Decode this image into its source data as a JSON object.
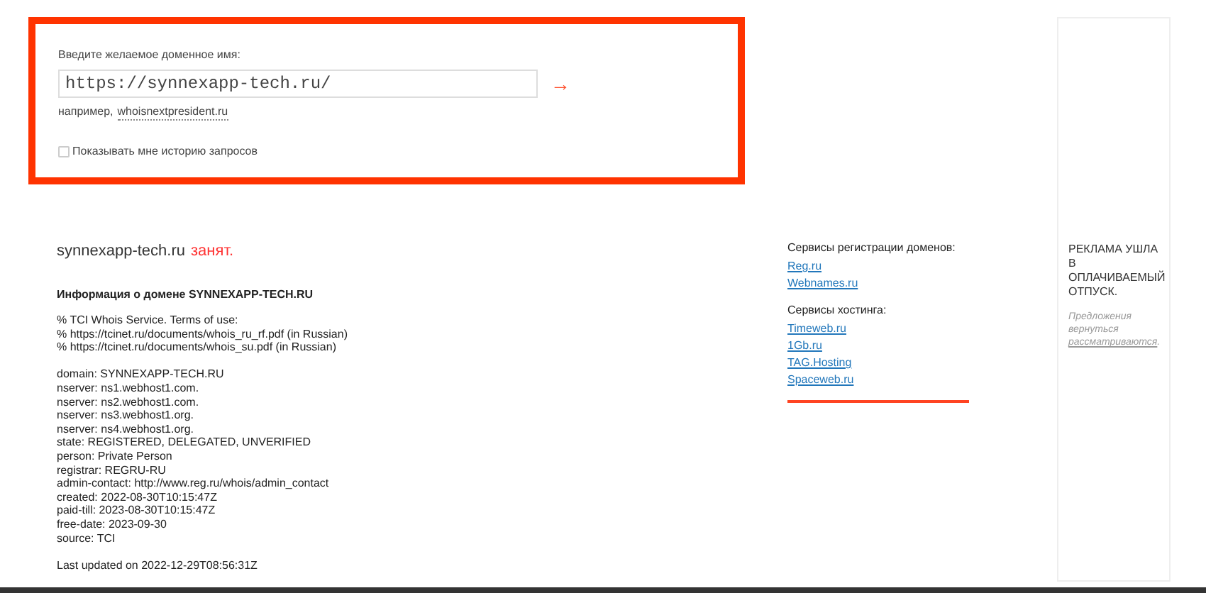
{
  "search_form": {
    "label": "Введите желаемое доменное имя:",
    "value": "https://synnexapp-tech.ru/",
    "submit_icon": "→",
    "example_prefix": "например,",
    "example_link": "whoisnextpresident.ru",
    "history_checkbox": {
      "label": "Показывать мне историю запросов",
      "checked": false
    }
  },
  "result": {
    "domain": "synnexapp-tech.ru",
    "status": "занят.",
    "info_title": "Информация о домене SYNNEXAPP-TECH.RU",
    "header_lines": [
      "% TCI Whois Service. Terms of use:",
      "% https://tcinet.ru/documents/whois_ru_rf.pdf (in Russian)",
      "% https://tcinet.ru/documents/whois_su.pdf (in Russian)"
    ],
    "record_lines": [
      "domain: SYNNEXAPP-TECH.RU",
      "nserver: ns1.webhost1.com.",
      "nserver: ns2.webhost1.com.",
      "nserver: ns3.webhost1.org.",
      "nserver: ns4.webhost1.org.",
      "state: REGISTERED, DELEGATED, UNVERIFIED",
      "person: Private Person",
      "registrar: REGRU-RU",
      "admin-contact: http://www.reg.ru/whois/admin_contact",
      "created: 2022-08-30T10:15:47Z",
      "paid-till: 2023-08-30T10:15:47Z",
      "free-date: 2023-09-30",
      "source: TCI"
    ],
    "last_updated": "Last updated on 2022-12-29T08:56:31Z"
  },
  "services": [
    {
      "title": "Сервисы регистрации доменов:",
      "links": [
        "Reg.ru",
        "Webnames.ru"
      ]
    },
    {
      "title": "Сервисы хостинга:",
      "links": [
        "Timeweb.ru",
        "1Gb.ru",
        "TAG.Hosting",
        "Spaceweb.ru"
      ]
    }
  ],
  "ad": {
    "title": "РЕКЛАМА УШЛА В ОПЛАЧИВАЕМЫЙ ОТПУСК.",
    "note_prefix": "Предложения вернуться",
    "note_link": "рассматриваются",
    "note_suffix": "."
  }
}
